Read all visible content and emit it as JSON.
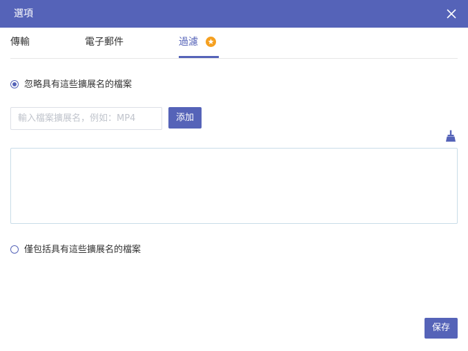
{
  "dialog": {
    "title": "選項",
    "close_icon": "close-icon"
  },
  "tabs": [
    {
      "label": "傳輸",
      "active": false
    },
    {
      "label": "電子郵件",
      "active": false
    },
    {
      "label": "過濾",
      "active": true,
      "badge_icon": "star-badge-icon"
    }
  ],
  "filter": {
    "ignore_option": {
      "label": "忽略具有這些擴展名的檔案",
      "checked": true
    },
    "extension_input": {
      "value": "",
      "placeholder": "輸入檔案擴展名，例如：MP4"
    },
    "add_label": "添加",
    "clear_icon": "broom-icon",
    "extension_list": "",
    "include_option": {
      "label": "僅包括具有這些擴展名的檔案",
      "checked": false
    }
  },
  "footer": {
    "save_label": "保存"
  },
  "colors": {
    "accent": "#5563b8",
    "badge": "#f5a020"
  }
}
